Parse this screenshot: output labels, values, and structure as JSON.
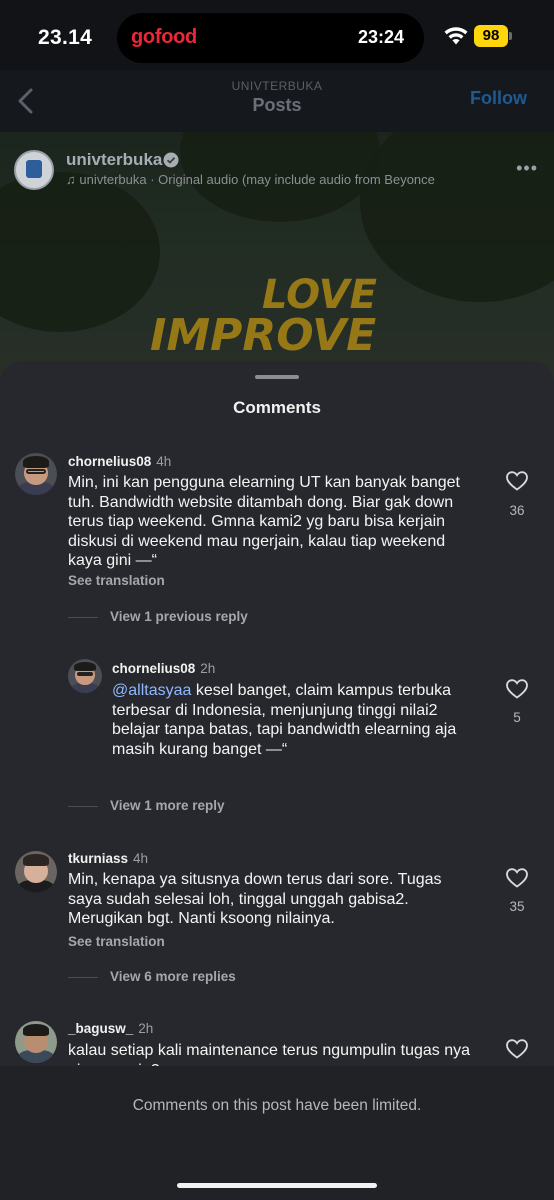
{
  "status_bar": {
    "time": "23.14",
    "island_brand": "gofood",
    "island_time": "23:24",
    "battery_level": "98",
    "battery_color": "#ffd60a"
  },
  "header": {
    "account": "UNIVTERBUKA",
    "title": "Posts",
    "follow_label": "Follow",
    "back_icon": "chevron-left-icon"
  },
  "post": {
    "username": "univterbuka",
    "audio": "univterbuka · Original audio  (may include audio from Beyonce",
    "more_icon": "more-horizontal-icon",
    "poster_lines": [
      "LOVE",
      "IMPROVE"
    ]
  },
  "comments_sheet": {
    "title": "Comments",
    "comments": [
      {
        "username": "chornelius08",
        "time": "4h",
        "text": "Min, ini kan pengguna elearning UT kan banyak banget tuh. Bandwidth website ditambah dong. Biar gak down terus tiap weekend. Gmna kami2 yg baru bisa kerjain diskusi di weekend mau ngerjain, kalau tiap weekend kaya gini —“",
        "likes": "36",
        "see_translation": "See translation",
        "replies_link": "View 1 previous reply"
      },
      {
        "username": "chornelius08",
        "time": "2h",
        "mention": "@alltasyaa",
        "text": " kesel banget, claim kampus terbuka terbesar di Indonesia, menjunjung tinggi nilai2 belajar tanpa batas, tapi bandwidth elearning aja masih kurang banget —“",
        "likes": "5",
        "replies_link": "View 1 more reply"
      },
      {
        "username": "tkurniass",
        "time": "4h",
        "text": "Min, kenapa ya situsnya down terus dari sore. Tugas saya sudah selesai loh, tinggal unggah gabisa2. Merugikan bgt. Nanti ksoong nilainya.",
        "likes": "35",
        "see_translation": "See translation",
        "replies_link": "View 6 more replies"
      },
      {
        "username": "_bagusw_",
        "time": "2h",
        "text": "kalau setiap kali maintenance terus ngumpulin tugas nya gimana min?"
      }
    ],
    "footer_note": "Comments on this post have been limited."
  }
}
